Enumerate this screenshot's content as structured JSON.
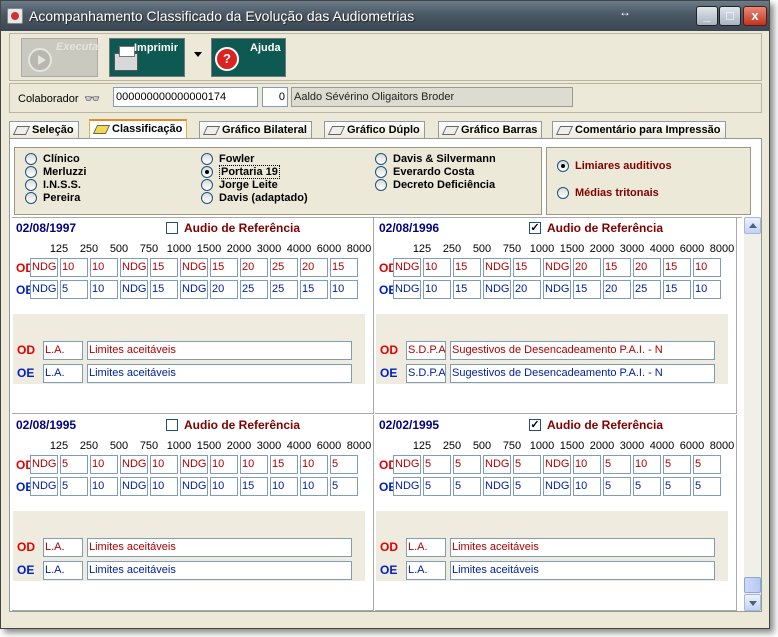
{
  "window": {
    "title": "Acompanhamento Classificado da Evolução das Audiometrias",
    "resize_glyph": "↔",
    "min": "_",
    "max": "□",
    "close": "x"
  },
  "toolbar": {
    "executar": "Executar",
    "imprimir": "Imprimir",
    "ajuda": "Ajuda"
  },
  "colaborador": {
    "label": "Colaborador",
    "code": "000000000000000174",
    "num": "0",
    "name": "Aaldo Sévérino Oligaitors Broder"
  },
  "tabs": [
    "Seleção",
    "Classificação",
    "Gráfico Bilateral",
    "Gráfico Dúplo",
    "Gráfico Barras",
    "Comentário para Impressão"
  ],
  "active_tab": 1,
  "classificacao": {
    "col1": [
      "Clínico",
      "Merluzzi",
      "I.N.S.S.",
      "Pereira"
    ],
    "col2": [
      "Fowler",
      "Portaria 19",
      "Jorge Leite",
      "Davis (adaptado)"
    ],
    "col3": [
      "Davis & Silvermann",
      "Everardo Costa",
      "Decreto Deficiência"
    ],
    "selected": "Portaria 19"
  },
  "limiares": {
    "options": [
      "Limiares auditivos",
      "Médias tritonais"
    ],
    "selected": "Limiares auditivos"
  },
  "labels": {
    "ref": "Audio de Referência",
    "od": "OD",
    "oe": "OE"
  },
  "frequencies": [
    "125",
    "250",
    "500",
    "750",
    "1000",
    "1500",
    "2000",
    "3000",
    "4000",
    "6000",
    "8000"
  ],
  "exams": [
    {
      "date": "02/08/1997",
      "reference": false,
      "od": [
        "NDG",
        "10",
        "10",
        "NDG",
        "15",
        "NDG",
        "15",
        "20",
        "25",
        "20",
        "15"
      ],
      "oe": [
        "NDG",
        "5",
        "10",
        "NDG",
        "15",
        "NDG",
        "20",
        "25",
        "25",
        "15",
        "10"
      ],
      "od_code": "L.A.",
      "od_desc": "Limites aceitáveis",
      "oe_code": "L.A.",
      "oe_desc": "Limites aceitáveis"
    },
    {
      "date": "02/08/1996",
      "reference": true,
      "od": [
        "NDG",
        "10",
        "15",
        "NDG",
        "15",
        "NDG",
        "20",
        "15",
        "20",
        "15",
        "10"
      ],
      "oe": [
        "NDG",
        "10",
        "15",
        "NDG",
        "20",
        "NDG",
        "15",
        "20",
        "25",
        "15",
        "10"
      ],
      "od_code": "S.D.P.A",
      "od_desc": "Sugestivos de Desencadeamento P.A.I. - N",
      "oe_code": "S.D.P.A",
      "oe_desc": "Sugestivos de Desencadeamento P.A.I. - N"
    },
    {
      "date": "02/08/1995",
      "reference": false,
      "od": [
        "NDG",
        "5",
        "10",
        "NDG",
        "10",
        "NDG",
        "10",
        "10",
        "15",
        "10",
        "5"
      ],
      "oe": [
        "NDG",
        "5",
        "10",
        "NDG",
        "10",
        "NDG",
        "10",
        "15",
        "10",
        "10",
        "5"
      ],
      "od_code": "L.A.",
      "od_desc": "Limites aceitáveis",
      "oe_code": "L.A.",
      "oe_desc": "Limites aceitáveis"
    },
    {
      "date": "02/02/1995",
      "reference": true,
      "od": [
        "NDG",
        "5",
        "5",
        "NDG",
        "5",
        "NDG",
        "10",
        "5",
        "10",
        "5",
        "5"
      ],
      "oe": [
        "NDG",
        "5",
        "5",
        "NDG",
        "5",
        "NDG",
        "10",
        "5",
        "5",
        "5",
        "5"
      ],
      "od_code": "L.A.",
      "od_desc": "Limites aceitáveis",
      "oe_code": "L.A.",
      "oe_desc": "Limites aceitáveis"
    }
  ]
}
